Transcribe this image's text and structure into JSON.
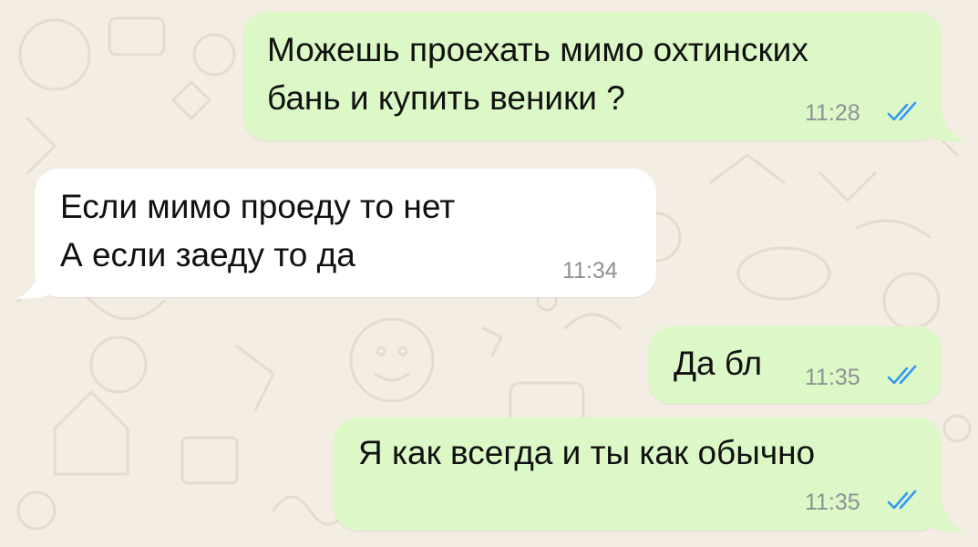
{
  "colors": {
    "wallpaper": "#f3ede3",
    "outgoing_bubble": "#dcf8c6",
    "incoming_bubble": "#ffffff",
    "read_ticks": "#3497f9",
    "timestamp": "#8d9196"
  },
  "messages": [
    {
      "direction": "outgoing",
      "lines": [
        "Можешь проехать мимо охтинских",
        "бань и купить веники ?"
      ],
      "time": "11:28",
      "status": "read",
      "status_icon": "double-check-icon"
    },
    {
      "direction": "incoming",
      "lines": [
        "Если мимо проеду то нет",
        "А если заеду то да"
      ],
      "time": "11:34"
    },
    {
      "direction": "outgoing",
      "lines": [
        "Да бл"
      ],
      "time": "11:35",
      "status": "read",
      "status_icon": "double-check-icon"
    },
    {
      "direction": "outgoing",
      "lines": [
        "Я как всегда и ты как обычно"
      ],
      "time": "11:35",
      "status": "read",
      "status_icon": "double-check-icon"
    }
  ]
}
